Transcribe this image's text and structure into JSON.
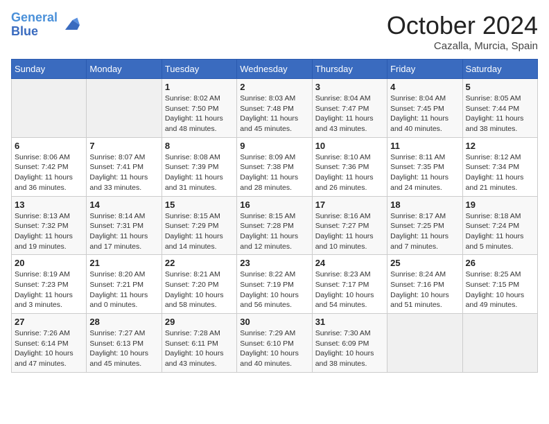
{
  "header": {
    "logo_line1": "General",
    "logo_line2": "Blue",
    "month": "October 2024",
    "location": "Cazalla, Murcia, Spain"
  },
  "days_of_week": [
    "Sunday",
    "Monday",
    "Tuesday",
    "Wednesday",
    "Thursday",
    "Friday",
    "Saturday"
  ],
  "weeks": [
    [
      {
        "day": "",
        "detail": ""
      },
      {
        "day": "",
        "detail": ""
      },
      {
        "day": "1",
        "detail": "Sunrise: 8:02 AM\nSunset: 7:50 PM\nDaylight: 11 hours\nand 48 minutes."
      },
      {
        "day": "2",
        "detail": "Sunrise: 8:03 AM\nSunset: 7:48 PM\nDaylight: 11 hours\nand 45 minutes."
      },
      {
        "day": "3",
        "detail": "Sunrise: 8:04 AM\nSunset: 7:47 PM\nDaylight: 11 hours\nand 43 minutes."
      },
      {
        "day": "4",
        "detail": "Sunrise: 8:04 AM\nSunset: 7:45 PM\nDaylight: 11 hours\nand 40 minutes."
      },
      {
        "day": "5",
        "detail": "Sunrise: 8:05 AM\nSunset: 7:44 PM\nDaylight: 11 hours\nand 38 minutes."
      }
    ],
    [
      {
        "day": "6",
        "detail": "Sunrise: 8:06 AM\nSunset: 7:42 PM\nDaylight: 11 hours\nand 36 minutes."
      },
      {
        "day": "7",
        "detail": "Sunrise: 8:07 AM\nSunset: 7:41 PM\nDaylight: 11 hours\nand 33 minutes."
      },
      {
        "day": "8",
        "detail": "Sunrise: 8:08 AM\nSunset: 7:39 PM\nDaylight: 11 hours\nand 31 minutes."
      },
      {
        "day": "9",
        "detail": "Sunrise: 8:09 AM\nSunset: 7:38 PM\nDaylight: 11 hours\nand 28 minutes."
      },
      {
        "day": "10",
        "detail": "Sunrise: 8:10 AM\nSunset: 7:36 PM\nDaylight: 11 hours\nand 26 minutes."
      },
      {
        "day": "11",
        "detail": "Sunrise: 8:11 AM\nSunset: 7:35 PM\nDaylight: 11 hours\nand 24 minutes."
      },
      {
        "day": "12",
        "detail": "Sunrise: 8:12 AM\nSunset: 7:34 PM\nDaylight: 11 hours\nand 21 minutes."
      }
    ],
    [
      {
        "day": "13",
        "detail": "Sunrise: 8:13 AM\nSunset: 7:32 PM\nDaylight: 11 hours\nand 19 minutes."
      },
      {
        "day": "14",
        "detail": "Sunrise: 8:14 AM\nSunset: 7:31 PM\nDaylight: 11 hours\nand 17 minutes."
      },
      {
        "day": "15",
        "detail": "Sunrise: 8:15 AM\nSunset: 7:29 PM\nDaylight: 11 hours\nand 14 minutes."
      },
      {
        "day": "16",
        "detail": "Sunrise: 8:15 AM\nSunset: 7:28 PM\nDaylight: 11 hours\nand 12 minutes."
      },
      {
        "day": "17",
        "detail": "Sunrise: 8:16 AM\nSunset: 7:27 PM\nDaylight: 11 hours\nand 10 minutes."
      },
      {
        "day": "18",
        "detail": "Sunrise: 8:17 AM\nSunset: 7:25 PM\nDaylight: 11 hours\nand 7 minutes."
      },
      {
        "day": "19",
        "detail": "Sunrise: 8:18 AM\nSunset: 7:24 PM\nDaylight: 11 hours\nand 5 minutes."
      }
    ],
    [
      {
        "day": "20",
        "detail": "Sunrise: 8:19 AM\nSunset: 7:23 PM\nDaylight: 11 hours\nand 3 minutes."
      },
      {
        "day": "21",
        "detail": "Sunrise: 8:20 AM\nSunset: 7:21 PM\nDaylight: 11 hours\nand 0 minutes."
      },
      {
        "day": "22",
        "detail": "Sunrise: 8:21 AM\nSunset: 7:20 PM\nDaylight: 10 hours\nand 58 minutes."
      },
      {
        "day": "23",
        "detail": "Sunrise: 8:22 AM\nSunset: 7:19 PM\nDaylight: 10 hours\nand 56 minutes."
      },
      {
        "day": "24",
        "detail": "Sunrise: 8:23 AM\nSunset: 7:17 PM\nDaylight: 10 hours\nand 54 minutes."
      },
      {
        "day": "25",
        "detail": "Sunrise: 8:24 AM\nSunset: 7:16 PM\nDaylight: 10 hours\nand 51 minutes."
      },
      {
        "day": "26",
        "detail": "Sunrise: 8:25 AM\nSunset: 7:15 PM\nDaylight: 10 hours\nand 49 minutes."
      }
    ],
    [
      {
        "day": "27",
        "detail": "Sunrise: 7:26 AM\nSunset: 6:14 PM\nDaylight: 10 hours\nand 47 minutes."
      },
      {
        "day": "28",
        "detail": "Sunrise: 7:27 AM\nSunset: 6:13 PM\nDaylight: 10 hours\nand 45 minutes."
      },
      {
        "day": "29",
        "detail": "Sunrise: 7:28 AM\nSunset: 6:11 PM\nDaylight: 10 hours\nand 43 minutes."
      },
      {
        "day": "30",
        "detail": "Sunrise: 7:29 AM\nSunset: 6:10 PM\nDaylight: 10 hours\nand 40 minutes."
      },
      {
        "day": "31",
        "detail": "Sunrise: 7:30 AM\nSunset: 6:09 PM\nDaylight: 10 hours\nand 38 minutes."
      },
      {
        "day": "",
        "detail": ""
      },
      {
        "day": "",
        "detail": ""
      }
    ]
  ]
}
